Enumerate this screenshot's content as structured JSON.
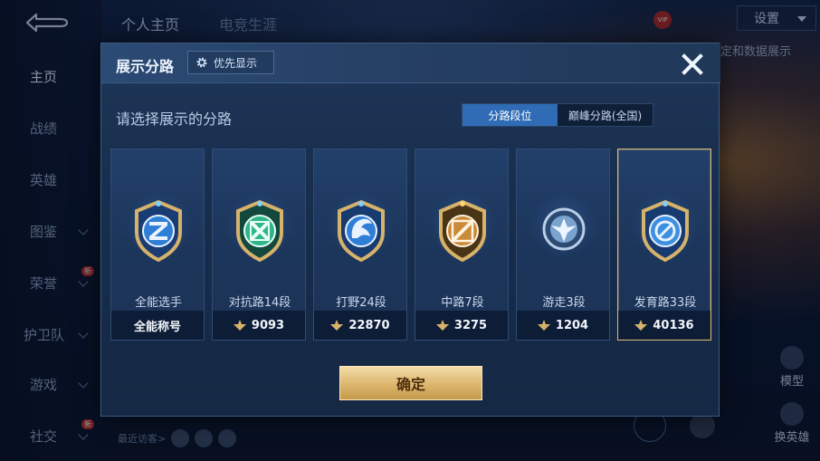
{
  "background": {
    "nav": [
      {
        "label": "主页",
        "active": true
      },
      {
        "label": "战绩"
      },
      {
        "label": "英雄"
      },
      {
        "label": "图鉴"
      },
      {
        "label": "荣誉",
        "badge": "新"
      },
      {
        "label": "护卫队"
      },
      {
        "label": "游戏"
      },
      {
        "label": "社交",
        "badge": "新"
      }
    ],
    "top_tabs": [
      "个人主页",
      "电竞生涯"
    ],
    "settings_label": "设置",
    "data_show_label": "定和数据展示",
    "model_label": "模型",
    "swap_hero_label": "换英雄",
    "recent_visitors_label": "最近访客>",
    "vip_label": "VIP"
  },
  "modal": {
    "title": "展示分路",
    "priority_label": "优先显示",
    "subtitle": "请选择展示的分路",
    "segments": [
      "分路段位",
      "巅峰分路(全国)"
    ],
    "active_segment": 0,
    "cards": [
      {
        "name": "全能选手",
        "footer": "全能称号",
        "score": null,
        "emblem": "all-round-emblem",
        "color": "#2f7fd6",
        "selected": false
      },
      {
        "name": "对抗路14段",
        "footer": "9093",
        "score": 9093,
        "emblem": "clash-lane-emblem",
        "color": "#2fb58a",
        "selected": false
      },
      {
        "name": "打野24段",
        "footer": "22870",
        "score": 22870,
        "emblem": "jungle-emblem",
        "color": "#2f7fd6",
        "selected": false
      },
      {
        "name": "中路7段",
        "footer": "3275",
        "score": 3275,
        "emblem": "mid-lane-emblem",
        "color": "#c98a3a",
        "selected": false
      },
      {
        "name": "游走3段",
        "footer": "1204",
        "score": 1204,
        "emblem": "roam-emblem",
        "color": "#7aa3cf",
        "selected": false
      },
      {
        "name": "发育路33段",
        "footer": "40136",
        "score": 40136,
        "emblem": "farm-lane-emblem",
        "color": "#3d8fe0",
        "selected": true
      }
    ],
    "confirm_label": "确定"
  }
}
